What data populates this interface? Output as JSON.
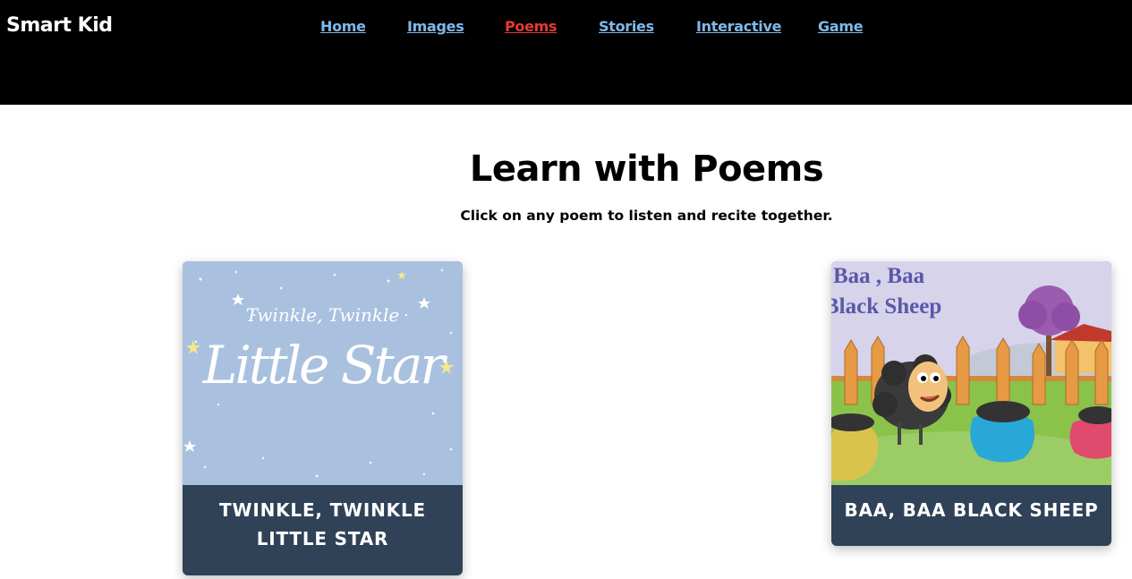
{
  "header": {
    "brand": "Smart Kid",
    "nav": [
      {
        "label": "Home",
        "active": false
      },
      {
        "label": "Images",
        "active": false
      },
      {
        "label": "Poems",
        "active": true
      },
      {
        "label": "Stories",
        "active": false
      },
      {
        "label": "Interactive",
        "active": false
      },
      {
        "label": "Game",
        "active": false
      }
    ]
  },
  "main": {
    "title": "Learn with Poems",
    "subtitle": "Click on any poem to listen and recite together.",
    "cards": [
      {
        "caption": "TWINKLE, TWINKLE LITTLE STAR",
        "image_text_line1": "Twinkle, Twinkle",
        "image_text_line2": "Little Star"
      },
      {
        "caption": "BAA, BAA BLACK SHEEP",
        "image_text_line1": "Baa , Baa",
        "image_text_line2": "Black Sheep"
      }
    ]
  },
  "colors": {
    "header_bg": "#000000",
    "nav_link": "#7fb9ea",
    "nav_active": "#e53935",
    "card_caption_bg": "#2f4257"
  }
}
